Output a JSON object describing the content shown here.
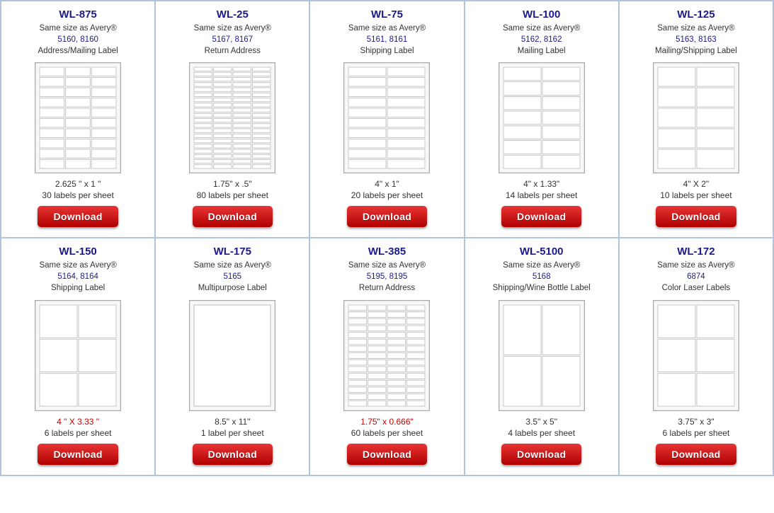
{
  "products": [
    {
      "id": "wl-875",
      "title": "WL-875",
      "avery_line1": "Same size as Avery®",
      "avery_line2": "5160, 8160",
      "label_type": "Address/Mailing Label",
      "size": "2.625 \" x 1 \"",
      "size_has_color": false,
      "count": "30 labels per sheet",
      "preview_type": "grid",
      "cols": 3,
      "rows": 10,
      "preview_w": 120,
      "preview_h": 155
    },
    {
      "id": "wl-25",
      "title": "WL-25",
      "avery_line1": "Same size as Avery®",
      "avery_line2": "5167, 8167",
      "label_type": "Return Address",
      "size": "1.75\" x .5\"",
      "size_has_color": false,
      "count": "80 labels per sheet",
      "preview_type": "grid",
      "cols": 4,
      "rows": 20,
      "preview_w": 120,
      "preview_h": 155
    },
    {
      "id": "wl-75",
      "title": "WL-75",
      "avery_line1": "Same size as Avery®",
      "avery_line2": "5161, 8161",
      "label_type": "Shipping Label",
      "size": "4\" x 1\"",
      "size_has_color": false,
      "count": "20 labels per sheet",
      "preview_type": "grid",
      "cols": 2,
      "rows": 10,
      "preview_w": 120,
      "preview_h": 155
    },
    {
      "id": "wl-100",
      "title": "WL-100",
      "avery_line1": "Same size as Avery®",
      "avery_line2": "5162, 8162",
      "label_type": "Mailing Label",
      "size": "4\" x 1.33\"",
      "size_has_color": false,
      "count": "14 labels per sheet",
      "preview_type": "grid",
      "cols": 2,
      "rows": 7,
      "preview_w": 120,
      "preview_h": 155
    },
    {
      "id": "wl-125",
      "title": "WL-125",
      "avery_line1": "Same size as Avery®",
      "avery_line2": "5163, 8163",
      "label_type": "Mailing/Shipping Label",
      "size": "4\" X 2\"",
      "size_has_color": false,
      "count": "10 labels per sheet",
      "preview_type": "grid",
      "cols": 2,
      "rows": 5,
      "preview_w": 120,
      "preview_h": 155
    },
    {
      "id": "wl-150",
      "title": "WL-150",
      "avery_line1": "Same size as Avery®",
      "avery_line2": "5164, 8164",
      "label_type": "Shipping Label",
      "size": "4 \" X 3.33 \"",
      "size_has_color": true,
      "count": "6 labels per sheet",
      "preview_type": "grid",
      "cols": 2,
      "rows": 3,
      "preview_w": 120,
      "preview_h": 155
    },
    {
      "id": "wl-175",
      "title": "WL-175",
      "avery_line1": "Same size as Avery®",
      "avery_line2": "5165",
      "label_type": "Multipurpose Label",
      "size": "8.5\" x 11\"",
      "size_has_color": false,
      "count": "1 label per sheet",
      "preview_type": "single",
      "cols": 1,
      "rows": 1,
      "preview_w": 120,
      "preview_h": 155
    },
    {
      "id": "wl-385",
      "title": "WL-385",
      "avery_line1": "Same size as Avery®",
      "avery_line2": "5195, 8195",
      "label_type": "Return Address",
      "size": "1.75\" x 0.666\"",
      "size_has_color": true,
      "count": "60 labels per sheet",
      "preview_type": "grid",
      "cols": 4,
      "rows": 15,
      "preview_w": 120,
      "preview_h": 155
    },
    {
      "id": "wl-5100",
      "title": "WL-5100",
      "avery_line1": "Same size as Avery®",
      "avery_line2": "5168",
      "label_type": "Shipping/Wine Bottle Label",
      "size": "3.5\" x 5\"",
      "size_has_color": false,
      "count": "4 labels per sheet",
      "preview_type": "tall-grid",
      "cols": 2,
      "rows": 2,
      "preview_w": 120,
      "preview_h": 155
    },
    {
      "id": "wl-172",
      "title": "WL-172",
      "avery_line1": "Same size as Avery®",
      "avery_line2": "6874",
      "label_type": "Color Laser Labels",
      "size": "3.75\" x 3\"",
      "size_has_color": false,
      "count": "6 labels per sheet",
      "preview_type": "grid",
      "cols": 2,
      "rows": 3,
      "preview_w": 120,
      "preview_h": 155
    }
  ],
  "download_label": "Download"
}
